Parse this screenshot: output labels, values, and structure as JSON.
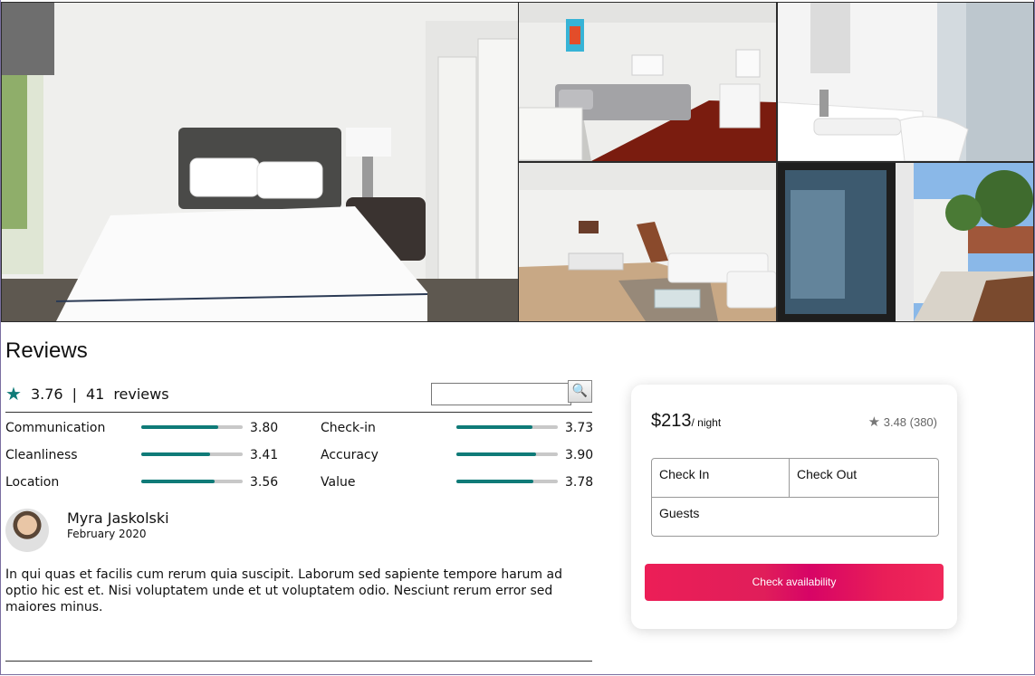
{
  "reviews": {
    "title": "Reviews",
    "rating": "3.76",
    "separator": "|",
    "count": "41",
    "count_label": "reviews",
    "categories": [
      {
        "label": "Communication",
        "score": "3.80",
        "fraction": 0.76
      },
      {
        "label": "Check-in",
        "score": "3.73",
        "fraction": 0.75
      },
      {
        "label": "Cleanliness",
        "score": "3.41",
        "fraction": 0.68
      },
      {
        "label": "Accuracy",
        "score": "3.90",
        "fraction": 0.79
      },
      {
        "label": "Location",
        "score": "3.56",
        "fraction": 0.72
      },
      {
        "label": "Value",
        "score": "3.78",
        "fraction": 0.76
      }
    ],
    "search": {
      "value": "",
      "placeholder": ""
    },
    "review": {
      "name": "Myra Jaskolski",
      "date": "February 2020",
      "text": "In qui quas et facilis cum rerum quia suscipit. Laborum sed sapiente tempore harum ad optio hic est et. Nisi voluptatem unde et ut voluptatem odio. Nesciunt rerum error sed maiores minus."
    }
  },
  "booking": {
    "price": "$213",
    "per_night": "/ night",
    "rating": "3.48 (380)",
    "check_in": "Check In",
    "check_out": "Check Out",
    "guests": "Guests",
    "button": "Check availability"
  },
  "colors": {
    "accent": "#0f7b78",
    "cta": "#e31c5f",
    "bar_bg": "#c8c8c8"
  },
  "icons": {
    "star": "star-icon",
    "search": "magnifier-icon"
  }
}
